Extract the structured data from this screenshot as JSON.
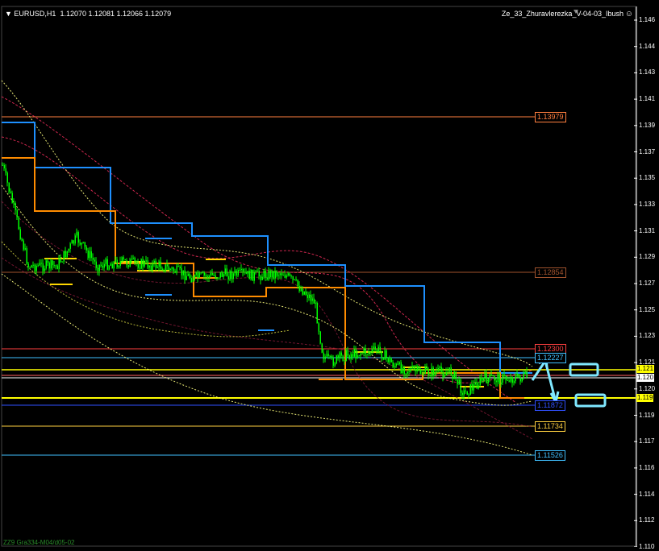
{
  "header": {
    "symbol": "EURUSD,H1",
    "ohlc": "1.12070 1.12081 1.12066 1.12079",
    "indicator": "Ze_33_Zhuravlerezka_V-04-03_Ibush"
  },
  "footer": {
    "label": "ZZ9 Gra334-M04/d05-02"
  },
  "axis": {
    "ticks": [
      "1.146",
      "1.144",
      "1.143",
      "1.141",
      "1.139",
      "1.137",
      "1.135",
      "1.133",
      "1.131",
      "1.129",
      "1.127",
      "1.125",
      "1.123",
      "1.121",
      "1.120",
      "1.119",
      "1.117",
      "1.116",
      "1.114",
      "1.112",
      "1.110"
    ],
    "badges": [
      {
        "text": "1.121",
        "color": "#ffff00"
      },
      {
        "text": "1.120",
        "color": "#ffffff"
      },
      {
        "text": "1.119",
        "color": "#ffff00"
      }
    ]
  },
  "price_lines": [
    {
      "label": "1.13979",
      "color": "#ff7f3f"
    },
    {
      "label": "1.12854",
      "color": "#a0522d"
    },
    {
      "label": "1.12300",
      "color": "#ff4040"
    },
    {
      "label": "1.12227",
      "color": "#40c0ff"
    },
    {
      "label": "1.11872",
      "color": "#3050ff"
    },
    {
      "label": "1.11734",
      "color": "#ffd040"
    },
    {
      "label": "1.11526",
      "color": "#40c0ff"
    }
  ],
  "colors": {
    "candles": "#00ff00",
    "upper_channel": "#1e90ff",
    "lower_channel": "#ff8c00",
    "signal_box": "#7fe8ff",
    "ma_dotted": "#ffff80",
    "envelope": "#ff3060"
  }
}
